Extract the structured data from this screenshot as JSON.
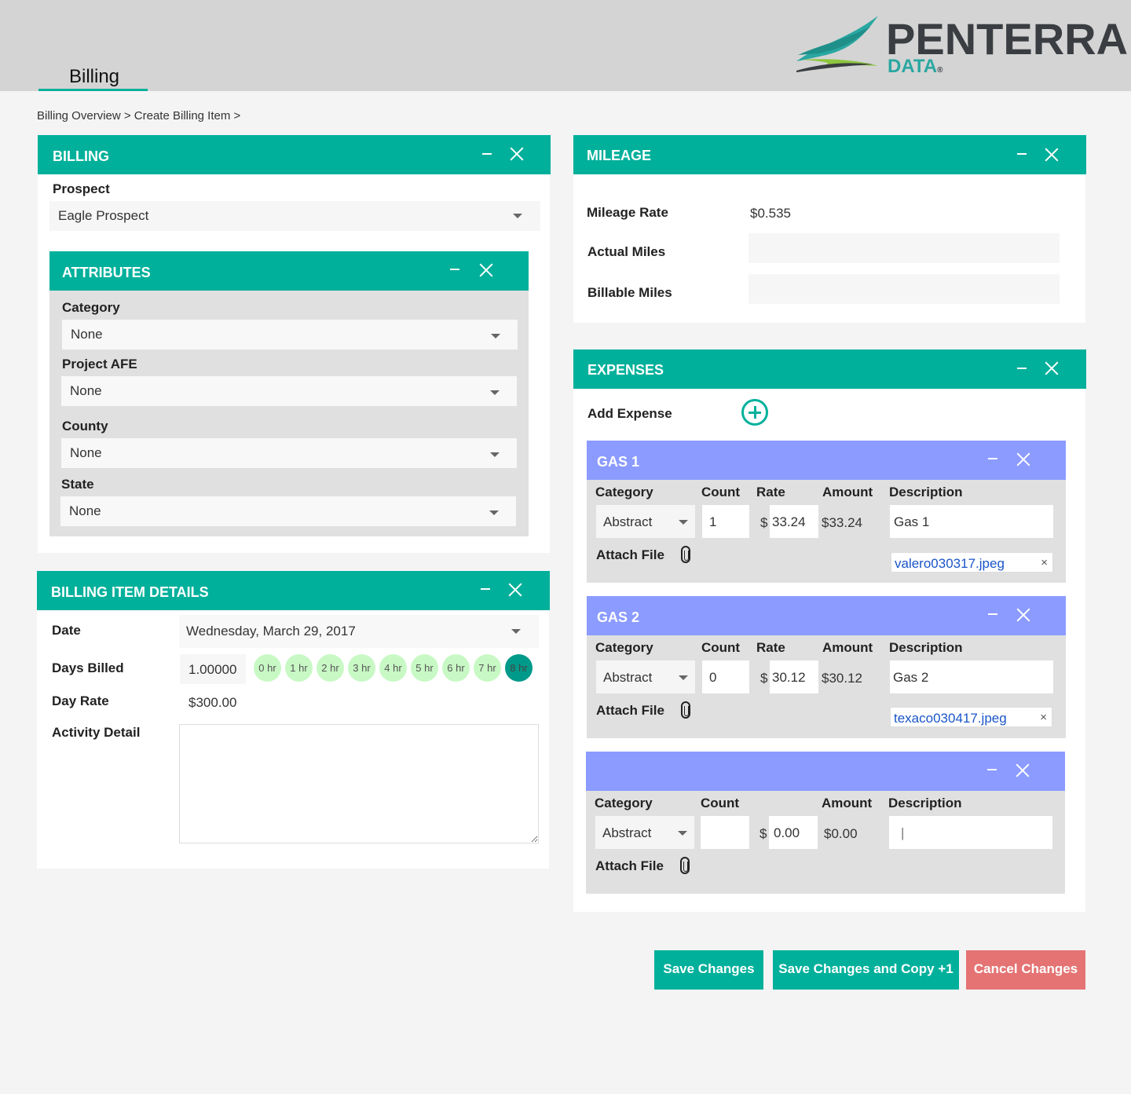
{
  "header": {
    "tab_label": "Billing",
    "logo_word": "PENTERRA",
    "logo_sub": "DATA",
    "logo_reg": "®"
  },
  "breadcrumb": "Billing Overview > Create Billing Item >",
  "billing": {
    "title": "BILLING",
    "prospect_label": "Prospect",
    "prospect_value": "Eagle Prospect"
  },
  "attributes": {
    "title": "ATTRIBUTES",
    "category_label": "Category",
    "category_value": "None",
    "afe_label": "Project AFE",
    "afe_value": "None",
    "county_label": "County",
    "county_value": "None",
    "state_label": "State",
    "state_value": "None"
  },
  "details": {
    "title": "BILLING ITEM DETAILS",
    "date_label": "Date",
    "date_value": "Wednesday, March 29, 2017",
    "days_label": "Days Billed",
    "days_value": "1.00000",
    "hours": [
      "0 hr",
      "1 hr",
      "2 hr",
      "3 hr",
      "4 hr",
      "5 hr",
      "6 hr",
      "7 hr",
      "8 hr"
    ],
    "selected_hour": "8 hr",
    "rate_label": "Day Rate",
    "rate_value": "$300.00",
    "activity_label": "Activity Detail",
    "activity_value": ""
  },
  "mileage": {
    "title": "MILEAGE",
    "rate_label": "Mileage Rate",
    "rate_value": "$0.535",
    "actual_label": "Actual Miles",
    "actual_value": "",
    "billable_label": "Billable Miles",
    "billable_value": ""
  },
  "expenses": {
    "title": "EXPENSES",
    "add_label": "Add Expense",
    "items": [
      {
        "title": "GAS 1",
        "col_category": "Category",
        "col_count": "Count",
        "col_rate": "Rate",
        "col_amount": "Amount",
        "col_desc": "Description",
        "category": "Abstract",
        "count": "1",
        "currency": "$",
        "rate": "33.24",
        "amount": "$33.24",
        "description": "Gas 1",
        "attach_label": "Attach File",
        "file": "valero030317.jpeg",
        "file_remove": "×"
      },
      {
        "title": "GAS 2",
        "col_category": "Category",
        "col_count": "Count",
        "col_rate": "Rate",
        "col_amount": "Amount",
        "col_desc": "Description",
        "category": "Abstract",
        "count": "0",
        "currency": "$",
        "rate": "30.12",
        "amount": "$30.12",
        "description": "Gas 2",
        "attach_label": "Attach File",
        "file": "texaco030417.jpeg",
        "file_remove": "×"
      },
      {
        "title": "",
        "col_category": "Category",
        "col_count": "Count",
        "col_amount": "Amount",
        "col_desc": "Description",
        "category": "Abstract",
        "count": "",
        "currency": "$",
        "rate": "0.00",
        "amount": "$0.00",
        "description": "|",
        "attach_label": "Attach File"
      }
    ]
  },
  "actions": {
    "save": "Save Changes",
    "save_copy": "Save Changes and Copy +1",
    "cancel": "Cancel Changes"
  },
  "colors": {
    "accent": "#00b09b",
    "expense_header": "#8b9bff",
    "cancel": "#e57373"
  }
}
